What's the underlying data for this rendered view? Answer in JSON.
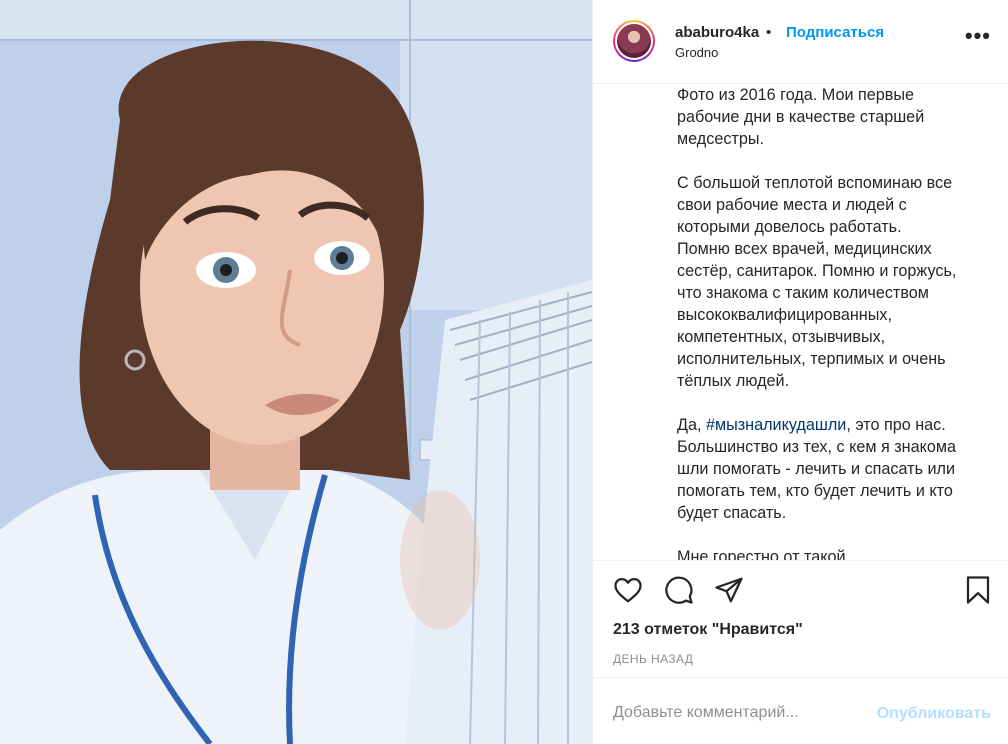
{
  "post": {
    "username": "ababuro4ka",
    "separator": "•",
    "follow_label": "Подписаться",
    "location": "Grodno",
    "more_label": "•••"
  },
  "caption": {
    "paragraph1": "Фото из 2016 года. Мои первые\nрабочие дни в качестве старшей\nмедсестры.",
    "paragraph2": "С большой теплотой вспоминаю все\nсвои рабочие места и людей с\nкоторыми довелось работать.\nПомню всех врачей, медицинских\nсестёр, санитарок. Помню и горжусь,\nчто знакома с таким количеством\nвысококвалифицированных,\nкомпетентных, отзывчивых,\nисполнительных, терпимых и очень\nтёплых людей.",
    "paragraph3_prefix": "Да, ",
    "hashtag": "#мызналикудашли",
    "paragraph3_rest": ", это про нас.\nБольшинство из тех, с кем я знакома\nшли помогать - лечить и спасать или\nпомогать тем, кто будет лечить и кто\nбудет спасать.",
    "paragraph4": "Мне горестно от такой"
  },
  "engagement": {
    "likes_label": "213 отметок \"Нравится\"",
    "time_label": "ДЕНЬ НАЗАД"
  },
  "comment": {
    "placeholder": "Добавьте комментарий...",
    "post_label": "Опубликовать"
  },
  "icons": {
    "like": "heart-icon",
    "comment": "comment-icon",
    "share": "share-icon",
    "save": "bookmark-icon"
  },
  "colors": {
    "link": "#0095f6",
    "hashtag": "#00376b",
    "muted": "#8e8e8e",
    "disabled_post": "#b2dffc"
  }
}
